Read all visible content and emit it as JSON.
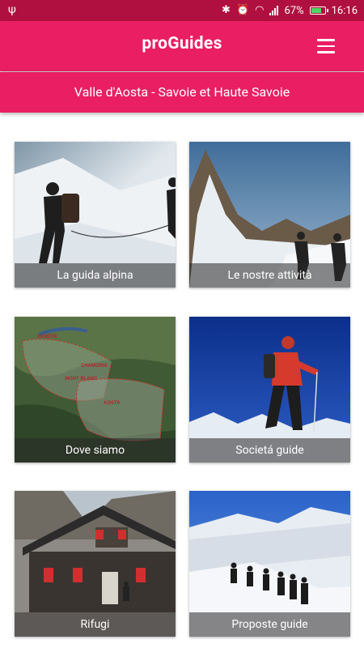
{
  "status_bar": {
    "battery_percent": "67%",
    "time": "16:16"
  },
  "app_bar": {
    "title": "proGuides",
    "menu_icon": "menu-icon"
  },
  "sub_bar": {
    "region": "Valle d'Aosta - Savoie et Haute Savoie"
  },
  "tiles": [
    {
      "label": "La guida alpina"
    },
    {
      "label": "Le nostre attività"
    },
    {
      "label": "Dove siamo"
    },
    {
      "label": "Societá guide"
    },
    {
      "label": "Rifugi"
    },
    {
      "label": "Proposte guide"
    }
  ],
  "map_labels": {
    "geneve": "GENEVE",
    "chamonix": "CHAMONIX",
    "mont_blanc": "MONT BLANC",
    "aosta": "AOSTA"
  },
  "colors": {
    "primary": "#e91e63",
    "status_bar": "#b0103f"
  }
}
